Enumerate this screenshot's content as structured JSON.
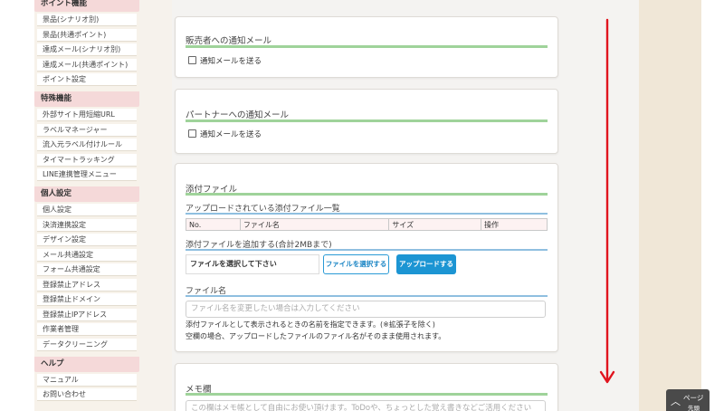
{
  "sidebar": {
    "sections": [
      {
        "title": "ポイント機能",
        "items": [
          "景品(シナリオ別)",
          "景品(共通ポイント)",
          "達成メール(シナリオ別)",
          "達成メール(共通ポイント)",
          "ポイント設定"
        ]
      },
      {
        "title": "特殊機能",
        "items": [
          "外部サイト用短縮URL",
          "ラベルマネージャー",
          "流入元ラベル付けルール",
          "タイマートラッキング",
          "LINE連携管理メニュー"
        ]
      },
      {
        "title": "個人設定",
        "items": [
          "個人設定",
          "決済連携設定",
          "デザイン設定",
          "メール共通設定",
          "フォーム共通設定",
          "登録禁止アドレス",
          "登録禁止ドメイン",
          "登録禁止IPアドレス",
          "作業者管理",
          "データクリーニング"
        ]
      },
      {
        "title": "ヘルプ",
        "items": [
          "マニュアル",
          "お問い合わせ"
        ]
      }
    ]
  },
  "seller_panel": {
    "title": "販売者への通知メール",
    "checkbox_label": "通知メールを送る"
  },
  "partner_panel": {
    "title": "パートナーへの通知メール",
    "checkbox_label": "通知メールを送る"
  },
  "attachment_panel": {
    "title": "添付ファイル",
    "uploaded_list_title": "アップロードされている添付ファイル一覧",
    "table_headers": [
      "No.",
      "ファイル名",
      "サイズ",
      "操作"
    ],
    "add_title": "添付ファイルを追加する(合計2MBまで)",
    "file_placeholder": "ファイルを選択して下さい",
    "select_button": "ファイルを選択する",
    "upload_button": "アップロードする",
    "filename_title": "ファイル名",
    "filename_placeholder": "ファイル名を変更したい場合は入力してください",
    "hint1": "添付ファイルとして表示されるときの名前を指定できます。(※拡張子を除く)",
    "hint2": "空欄の場合、アップロードしたファイルのファイル名がそのまま使用されます。"
  },
  "memo_panel": {
    "title": "メモ欄",
    "placeholder": "この欄はメモ帳として自由にお使い頂けます。ToDoや、ちょっとした覚え書きなどご活用ください"
  },
  "page_top": {
    "label": "ページ",
    "sublabel": "先頭"
  },
  "colors": {
    "accent_green": "#9fd39a",
    "accent_blue": "#1c95d3",
    "arrow_red": "#e0141e",
    "section_pink": "#f5d9d9"
  }
}
